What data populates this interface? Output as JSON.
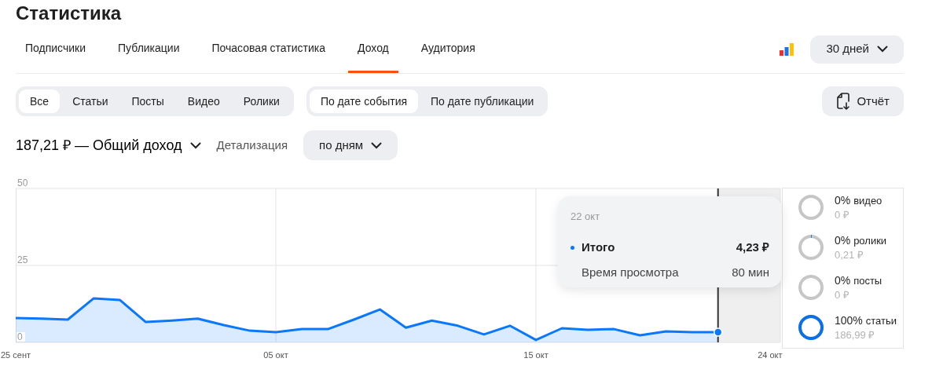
{
  "page_title": "Статистика",
  "tabs": [
    {
      "label": "Подписчики",
      "selected": false
    },
    {
      "label": "Публикации",
      "selected": false
    },
    {
      "label": "Почасовая статистика",
      "selected": false
    },
    {
      "label": "Доход",
      "selected": true
    },
    {
      "label": "Аудитория",
      "selected": false
    }
  ],
  "range_button": {
    "label": "30 дней"
  },
  "content_filters": [
    {
      "label": "Все",
      "selected": true
    },
    {
      "label": "Статьи",
      "selected": false
    },
    {
      "label": "Посты",
      "selected": false
    },
    {
      "label": "Видео",
      "selected": false
    },
    {
      "label": "Ролики",
      "selected": false
    }
  ],
  "date_filters": [
    {
      "label": "По дате события",
      "selected": true
    },
    {
      "label": "По дате публикации",
      "selected": false
    }
  ],
  "report_button": {
    "label": "Отчёт"
  },
  "summary": {
    "label": "187,21 ₽ — Общий доход"
  },
  "detail": {
    "label": "Детализация",
    "value": "по дням"
  },
  "chart": {
    "chart_data": {
      "type": "area",
      "categories": [
        "25 сент",
        null,
        null,
        null,
        null,
        null,
        null,
        null,
        null,
        null,
        "05 окт",
        null,
        null,
        null,
        null,
        null,
        null,
        null,
        null,
        null,
        "15 окт",
        null,
        null,
        null,
        null,
        null,
        null,
        null,
        null,
        "24 окт"
      ],
      "series": [
        {
          "name": "Итого",
          "color": "#0a77ff",
          "values": [
            7.9,
            7.7,
            7.4,
            14.3,
            13.8,
            6.6,
            7.1,
            7.7,
            5.6,
            3.8,
            3.3,
            4.3,
            4.3,
            7.4,
            10.7,
            4.8,
            7.1,
            5.4,
            2.6,
            5.4,
            0.8,
            4.6,
            4.1,
            4.3,
            2.3,
            3.6,
            3.3,
            3.3,
            null,
            null
          ]
        }
      ],
      "ylim": [
        0,
        50
      ],
      "grid": true,
      "yticks": [
        0,
        25,
        50
      ]
    },
    "hover": {
      "date": "22 окт",
      "rows": [
        {
          "kind": "total",
          "value": "4,23 ₽"
        },
        {
          "kind": "metric",
          "label": "Время просмотра",
          "value": "80 мин"
        }
      ]
    }
  },
  "breakdown": [
    {
      "percent": "0%",
      "name": "видео",
      "amount": "0 ₽",
      "level": 0
    },
    {
      "percent": "0%",
      "name": "ролики",
      "amount": "0,21 ₽",
      "level": 0.01
    },
    {
      "percent": "0%",
      "name": "посты",
      "amount": "0 ₽",
      "level": 0
    },
    {
      "percent": "100%",
      "name": "статьи",
      "amount": "186,99 ₽",
      "level": 1
    }
  ]
}
